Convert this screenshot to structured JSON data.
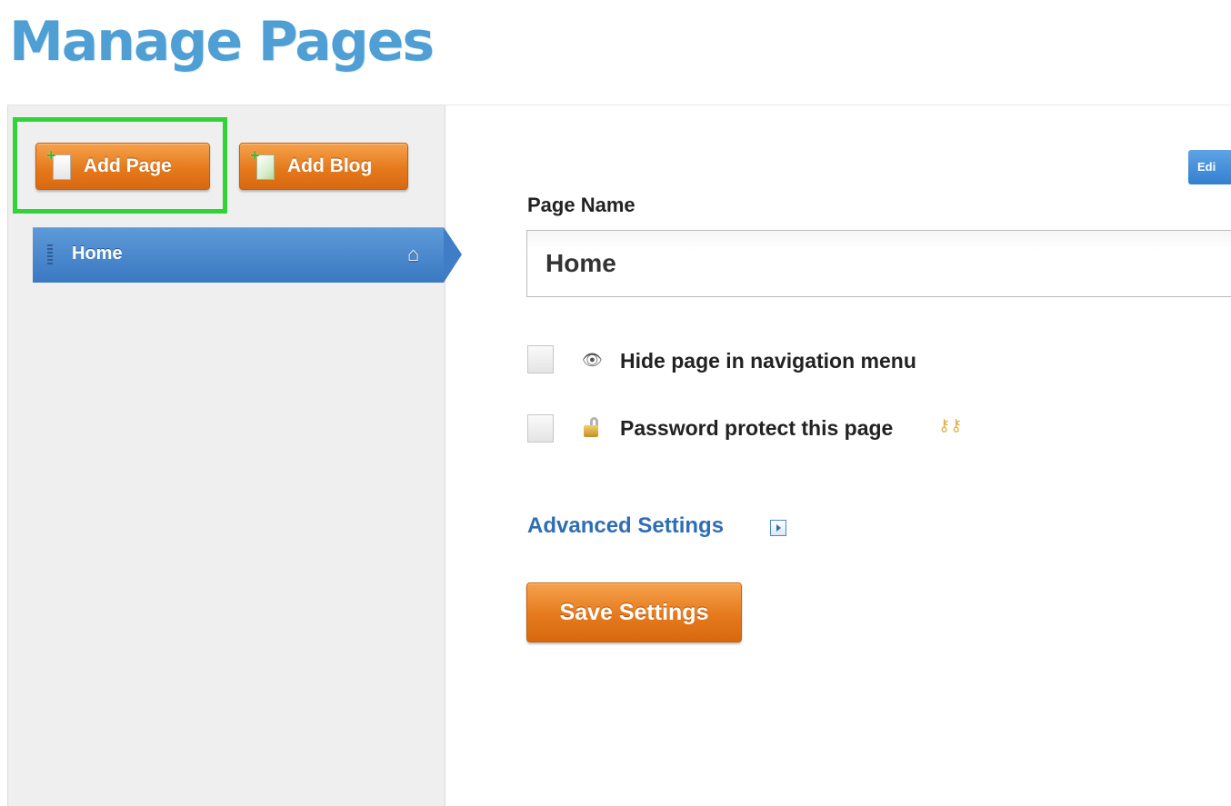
{
  "header": {
    "title": "Manage Pages"
  },
  "sidebar": {
    "buttons": {
      "add_page": "Add Page",
      "add_blog": "Add Blog"
    },
    "pages": [
      {
        "label": "Home",
        "icon": "home-icon",
        "selected": true
      }
    ],
    "highlight_color": "#32d338"
  },
  "main": {
    "edit_button": "Edi",
    "page_name": {
      "label": "Page Name",
      "value": "Home"
    },
    "options": {
      "hide_label": "Hide page in navigation menu",
      "hide_checked": false,
      "password_label": "Password protect this page",
      "password_checked": false
    },
    "advanced_link": "Advanced Settings",
    "save_button": "Save Settings"
  },
  "colors": {
    "title": "#4f9fd4",
    "accent_orange": "#e57a1d",
    "nav_blue": "#3a78c2",
    "link_blue": "#2f6db5"
  }
}
